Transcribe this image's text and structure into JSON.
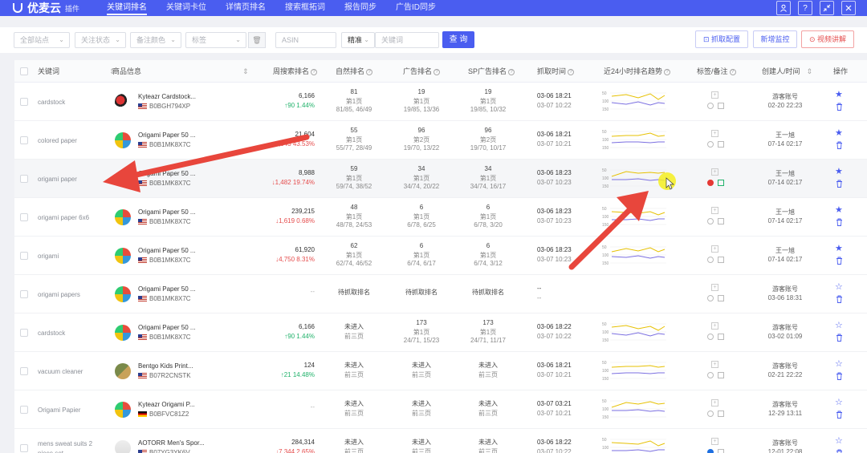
{
  "app": {
    "logo": "优麦云",
    "logo_sub": "插件"
  },
  "nav": [
    "关键词排名",
    "关键词卡位",
    "详情页排名",
    "搜索框拓词",
    "报告同步",
    "广告ID同步"
  ],
  "top_icons": [
    "user-icon",
    "help-icon",
    "collapse-icon",
    "close-icon"
  ],
  "filters": {
    "site": "全部站点",
    "follow": "关注状态",
    "color": "备注颜色",
    "tag": "标签",
    "asin_placeholder": "ASIN",
    "match": "精准",
    "keyword_placeholder": "关键词",
    "search": "查 询",
    "fetch_config": "抓取配置",
    "monitor": "新增监控",
    "video": "视频讲解"
  },
  "headers": {
    "keyword": "关键词",
    "product": "商品信息",
    "volume": "周搜索排名",
    "natural": "自然排名",
    "ad": "广告排名",
    "sp": "SP广告排名",
    "fetch_time": "抓取时间",
    "trend": "近24小时排名趋势",
    "tag": "标签/备注",
    "creator": "创建人/时间",
    "action": "操作"
  },
  "rows": [
    {
      "kw": "cardstock",
      "title": "Kyteazr Cardstock...",
      "asin": "B0BGH794XP",
      "flag": "us",
      "vol": "6,166",
      "chg": "↑90  1.44%",
      "dir": "up",
      "nat": [
        "81",
        "第1页",
        "81/85, 46/49"
      ],
      "ad": [
        "19",
        "第1页",
        "19/85, 13/36"
      ],
      "sp": [
        "19",
        "第1页",
        "19/85, 10/32"
      ],
      "t1": "03-06 18:21",
      "t2": "03-07 10:22",
      "creator": "游客账号",
      "ctime": "02-20 22:23",
      "starred": true
    },
    {
      "kw": "colored paper",
      "title": "Origami Paper 50 ...",
      "asin": "B0B1MK8X7C",
      "flag": "us",
      "vol": "21,604",
      "chg": "↓6,543  43.53%",
      "dir": "down",
      "nat": [
        "55",
        "第1页",
        "55/77, 28/49"
      ],
      "ad": [
        "96",
        "第2页",
        "19/70, 13/22"
      ],
      "sp": [
        "96",
        "第2页",
        "19/70, 10/17"
      ],
      "t1": "03-06 18:21",
      "t2": "03-07 10:21",
      "creator": "王一旭",
      "ctime": "07-14 02:17",
      "starred": true
    },
    {
      "kw": "origami paper",
      "title": "Origami Paper 50 ...",
      "asin": "B0B1MK8X7C",
      "flag": "us",
      "vol": "8,988",
      "chg": "↓1,482  19.74%",
      "dir": "down",
      "nat": [
        "59",
        "第1页",
        "59/74, 38/52"
      ],
      "ad": [
        "34",
        "第1页",
        "34/74, 20/22"
      ],
      "sp": [
        "34",
        "第1页",
        "34/74, 16/17"
      ],
      "t1": "03-06 18:23",
      "t2": "03-07 10:23",
      "creator": "王一旭",
      "ctime": "07-14 02:17",
      "starred": true
    },
    {
      "kw": "origami paper 6x6",
      "title": "Origami Paper 50 ...",
      "asin": "B0B1MK8X7C",
      "flag": "us",
      "vol": "239,215",
      "chg": "↓1,619  0.68%",
      "dir": "down",
      "nat": [
        "48",
        "第1页",
        "48/78, 24/53"
      ],
      "ad": [
        "6",
        "第1页",
        "6/78, 6/25"
      ],
      "sp": [
        "6",
        "第1页",
        "6/78, 3/20"
      ],
      "t1": "03-06 18:23",
      "t2": "03-07 10:23",
      "creator": "王一旭",
      "ctime": "07-14 02:17",
      "starred": true
    },
    {
      "kw": "origami",
      "title": "Origami Paper 50 ...",
      "asin": "B0B1MK8X7C",
      "flag": "us",
      "vol": "61,920",
      "chg": "↓4,750  8.31%",
      "dir": "down",
      "nat": [
        "62",
        "第1页",
        "62/74, 46/52"
      ],
      "ad": [
        "6",
        "第1页",
        "6/74, 6/17"
      ],
      "sp": [
        "6",
        "第1页",
        "6/74, 3/12"
      ],
      "t1": "03-06 18:23",
      "t2": "03-07 10:23",
      "creator": "王一旭",
      "ctime": "07-14 02:17",
      "starred": true
    },
    {
      "kw": "origami papers",
      "title": "Origami Paper 50 ...",
      "asin": "B0B1MK8X7C",
      "flag": "us",
      "vol": "--",
      "chg": "",
      "dir": "none",
      "nat": [
        "待抓取排名",
        "",
        ""
      ],
      "ad": [
        "待抓取排名",
        "",
        ""
      ],
      "sp": [
        "待抓取排名",
        "",
        ""
      ],
      "t1": "--",
      "t2": "--",
      "creator": "游客账号",
      "ctime": "03-06 18:31",
      "starred": false
    },
    {
      "kw": "cardstock",
      "title": "Origami Paper 50 ...",
      "asin": "B0B1MK8X7C",
      "flag": "us",
      "vol": "6,166",
      "chg": "↑90  1.44%",
      "dir": "up",
      "nat": [
        "未进入",
        "前三页",
        ""
      ],
      "ad": [
        "173",
        "第1页",
        "24/71, 15/23"
      ],
      "sp": [
        "173",
        "第1页",
        "24/71, 11/17"
      ],
      "t1": "03-06 18:22",
      "t2": "03-07 10:22",
      "creator": "游客账号",
      "ctime": "03-02 01:09",
      "starred": false
    },
    {
      "kw": "vacuum cleaner",
      "title": "Bentgo Kids Print...",
      "asin": "B07R2CNSTK",
      "flag": "us",
      "vol": "124",
      "chg": "↑21  14.48%",
      "dir": "up",
      "nat": [
        "未进入",
        "前三页",
        ""
      ],
      "ad": [
        "未进入",
        "前三页",
        ""
      ],
      "sp": [
        "未进入",
        "前三页",
        ""
      ],
      "t1": "03-06 18:21",
      "t2": "03-07 10:21",
      "creator": "游客账号",
      "ctime": "02-21 22:22",
      "starred": false
    },
    {
      "kw": "Origami Papier",
      "title": "Kyteazr Origami P...",
      "asin": "B0BFVC81Z2",
      "flag": "de",
      "vol": "--",
      "chg": "",
      "dir": "none",
      "nat": [
        "未进入",
        "前三页",
        ""
      ],
      "ad": [
        "未进入",
        "前三页",
        ""
      ],
      "sp": [
        "未进入",
        "前三页",
        ""
      ],
      "t1": "03-07 03:21",
      "t2": "03-07 10:21",
      "creator": "游客账号",
      "ctime": "12-29 13:11",
      "starred": false
    },
    {
      "kw": "mens sweat suits 2 piece set",
      "title": "AOTORR Men's Spor...",
      "asin": "B07YG3YK6V",
      "flag": "us",
      "vol": "284,314",
      "chg": "↓7,344  2.65%",
      "dir": "down",
      "nat": [
        "未进入",
        "前三页",
        ""
      ],
      "ad": [
        "未进入",
        "前三页",
        ""
      ],
      "sp": [
        "未进入",
        "前三页",
        ""
      ],
      "t1": "03-06 18:22",
      "t2": "03-07 10:22",
      "creator": "游客账号",
      "ctime": "12-01 22:08",
      "starred": false
    }
  ],
  "colors": {
    "brand": "#4a5df0",
    "up": "#21b26b",
    "down": "#e54d4d",
    "arrow": "#e8463c"
  }
}
